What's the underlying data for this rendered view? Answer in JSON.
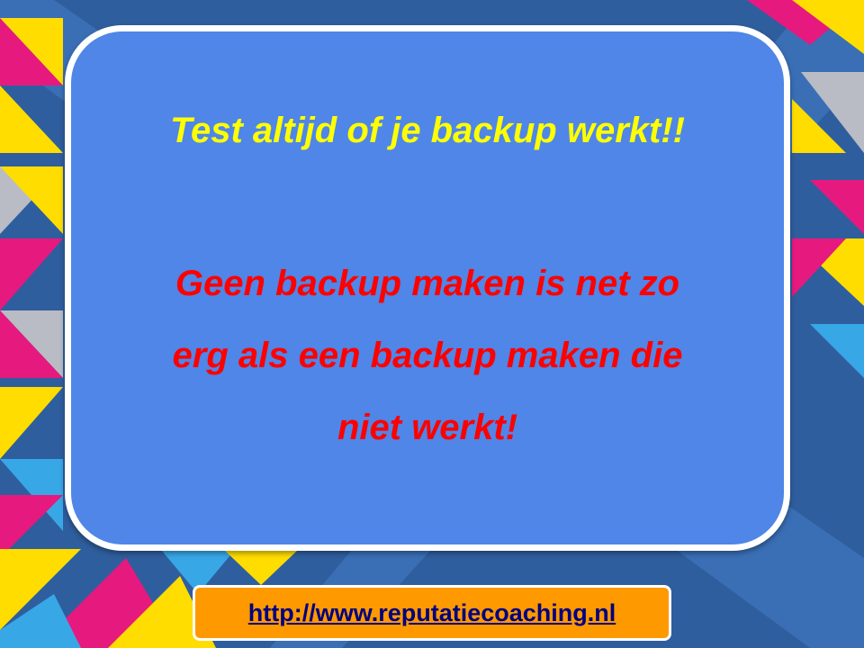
{
  "slide": {
    "headline": "Test altijd of je backup werkt!!",
    "message_lines": [
      "Geen backup maken is net zo",
      "erg als een backup maken die",
      "niet werkt!"
    ],
    "link": "http://www.reputatiecoaching.nl"
  },
  "colors": {
    "background": "#2f5e9e",
    "card": "#4f86e8",
    "headline": "#ffff00",
    "message": "#ff0000",
    "link_box": "#ff9900",
    "link_text": "#000080",
    "accent_pink": "#e6197f",
    "accent_yellow": "#ffdd00",
    "accent_cyan": "#38a7e6",
    "accent_grey": "#b9bcc4"
  }
}
